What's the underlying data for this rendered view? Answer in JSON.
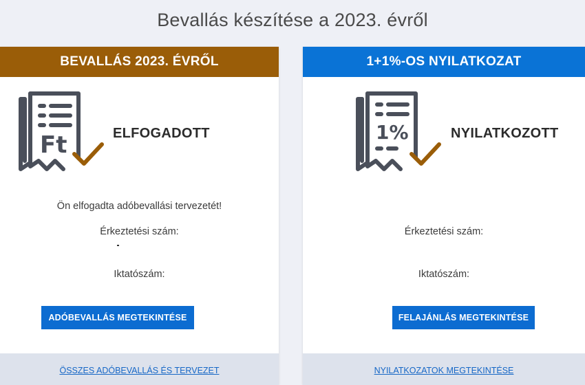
{
  "page": {
    "title": "Bevallás készítése a 2023. évről"
  },
  "left_card": {
    "header": "BEVALLÁS 2023. ÉVRŐL",
    "icon_glyph": "Ft",
    "status": "ELFOGADOTT",
    "message": "Ön elfogadta adóbevallási tervezetét!",
    "arrival_label": "Érkeztetési szám:",
    "filing_label": "Iktatószám:",
    "button": "ADÓBEVALLÁS MEGTEKINTÉSE",
    "footer_link": "ÖSSZES ADÓBEVALLÁS ÉS TERVEZET"
  },
  "right_card": {
    "header": "1+1%-OS NYILATKOZAT",
    "icon_glyph": "1%",
    "status": "NYILATKOZOTT",
    "arrival_label": "Érkeztetési szám:",
    "filing_label": "Iktatószám:",
    "button": "FELAJÁNLÁS MEGTEKINTÉSE",
    "footer_link": "NYILATKOZATOK MEGTEKINTÉSE"
  },
  "colors": {
    "header_left": "#9a5d08",
    "header_right": "#0a73d6",
    "button": "#0c6cd1",
    "check": "#9a5d08",
    "icon": "#4a4f5a"
  },
  "icons": [
    "document-ft-icon",
    "document-percent-icon",
    "checkmark-icon"
  ]
}
